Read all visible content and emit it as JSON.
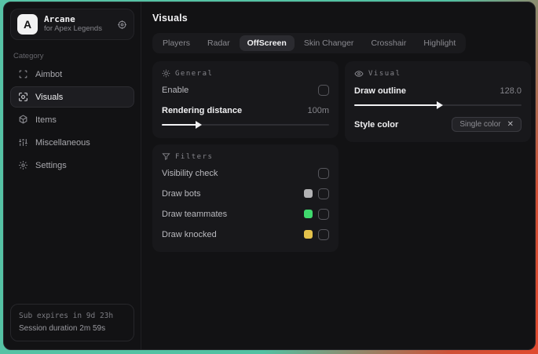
{
  "app": {
    "logo_letter": "A",
    "name": "Arcane",
    "subtitle": "for Apex Legends"
  },
  "sidebar": {
    "category_label": "Category",
    "items": [
      {
        "label": "Aimbot"
      },
      {
        "label": "Visuals"
      },
      {
        "label": "Items"
      },
      {
        "label": "Miscellaneous"
      },
      {
        "label": "Settings"
      }
    ],
    "status": {
      "line1": "Sub expires in 9d 23h",
      "line2": "Session duration 2m 59s"
    }
  },
  "main": {
    "title": "Visuals",
    "tabs": [
      {
        "label": "Players"
      },
      {
        "label": "Radar"
      },
      {
        "label": "OffScreen"
      },
      {
        "label": "Skin Changer"
      },
      {
        "label": "Crosshair"
      },
      {
        "label": "Highlight"
      }
    ],
    "active_tab": "OffScreen",
    "general": {
      "header": "General",
      "enable_label": "Enable",
      "rendering_label": "Rendering distance",
      "rendering_value": "100m",
      "rendering_percent": 21
    },
    "filters": {
      "header": "Filters",
      "rows": [
        {
          "label": "Visibility check",
          "swatch": ""
        },
        {
          "label": "Draw bots",
          "swatch": "#b3b3b5"
        },
        {
          "label": "Draw teammates",
          "swatch": "#3fd96d"
        },
        {
          "label": "Draw knocked",
          "swatch": "#e3c14b"
        }
      ]
    },
    "visual": {
      "header": "Visual",
      "outline_label": "Draw outline",
      "outline_value": "128.0",
      "outline_percent": 50,
      "style_label": "Style color",
      "style_value": "Single color",
      "style_clear": "✕"
    }
  },
  "colors": {
    "accent_teal": "#57c3a6",
    "accent_red": "#e04a2f",
    "window_bg": "#121214",
    "card_bg": "#18181b"
  }
}
